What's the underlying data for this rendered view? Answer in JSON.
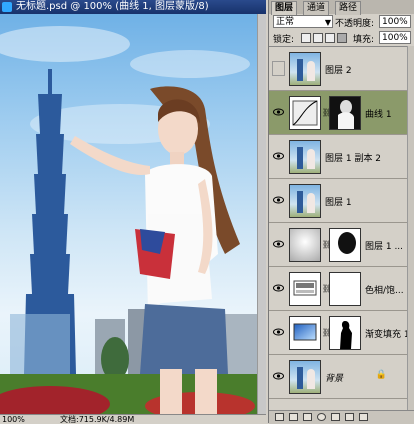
{
  "document": {
    "title": "无标题.psd @ 100% (曲线 1, 图层蒙版/8)",
    "zoom": "100%",
    "doc_size": "文档:715.9K/4.89M"
  },
  "panel": {
    "tabs": [
      {
        "label": "图层",
        "active": true
      },
      {
        "label": "通道",
        "active": false
      },
      {
        "label": "路径",
        "active": false
      }
    ],
    "blend_mode": "正常",
    "opacity_label": "不透明度:",
    "opacity_value": "100%",
    "lock_label": "锁定:",
    "fill_label": "填充:",
    "fill_value": "100%"
  },
  "layers": [
    {
      "name": "图层 2",
      "visible": false,
      "selected": false,
      "thumb": "photo",
      "mask": null
    },
    {
      "name": "曲线 1",
      "visible": true,
      "selected": true,
      "thumb": "curves-icon",
      "mask": "dark-figure-mask"
    },
    {
      "name": "图层 1 副本 2",
      "visible": true,
      "selected": false,
      "thumb": "photo",
      "mask": null
    },
    {
      "name": "图层 1",
      "visible": true,
      "selected": false,
      "thumb": "photo",
      "mask": null
    },
    {
      "name": "图层 1 ...",
      "visible": true,
      "selected": false,
      "thumb": "gradient-white",
      "mask": "dark-blob-mask"
    },
    {
      "name": "色相/饱...",
      "visible": true,
      "selected": false,
      "thumb": "hue-sat-icon",
      "mask": "white"
    },
    {
      "name": "渐变填充 1",
      "visible": true,
      "selected": false,
      "thumb": "gradient-icon",
      "mask": "figure-silhouette"
    },
    {
      "name": "背景",
      "visible": true,
      "selected": false,
      "thumb": "photo",
      "mask": null,
      "locked": true
    }
  ],
  "colors": {
    "selected_layer_bg": "#8b9a6a",
    "panel_bg": "#d4d0c8",
    "title_bar": "#2a4a8c"
  }
}
